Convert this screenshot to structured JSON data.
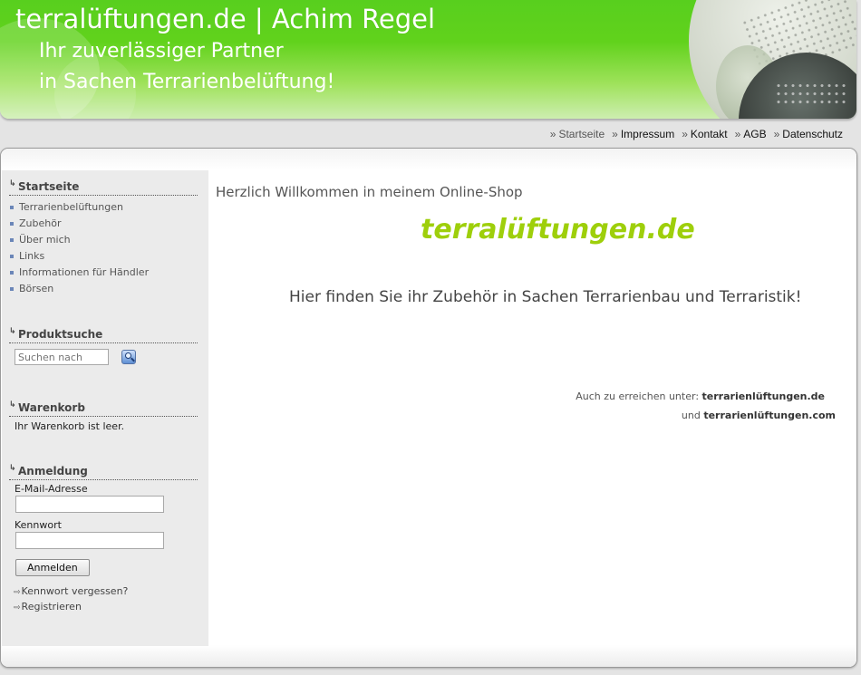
{
  "header": {
    "title": "terralüftungen.de | Achim Regel",
    "subtitle_line1": "Ihr zuverlässiger Partner",
    "subtitle_line2": "in Sachen Terrarienbelüftung!"
  },
  "topnav": {
    "separator": "»",
    "items": [
      {
        "label": "Startseite",
        "active": true
      },
      {
        "label": "Impressum",
        "active": false
      },
      {
        "label": "Kontakt",
        "active": false
      },
      {
        "label": "AGB",
        "active": false
      },
      {
        "label": "Datenschutz",
        "active": false
      }
    ]
  },
  "sidebar": {
    "home": {
      "title": "Startseite",
      "links": [
        "Terrarienbelüftungen",
        "Zubehör",
        "Über mich",
        "Links",
        "Informationen für Händler",
        "Börsen"
      ]
    },
    "search": {
      "title": "Produktsuche",
      "placeholder": "Suchen nach"
    },
    "cart": {
      "title": "Warenkorb",
      "text": "Ihr Warenkorb ist leer."
    },
    "login": {
      "title": "Anmeldung",
      "email_label": "E-Mail-Adresse",
      "password_label": "Kennwort",
      "button": "Anmelden",
      "forgot": "Kennwort vergessen?",
      "register": "Registrieren"
    }
  },
  "content": {
    "title": "Herzlich Willkommen in meinem Online-Shop",
    "brand": "terralüftungen.de",
    "tagline": "Hier finden Sie ihr Zubehör in Sachen Terrarienbau und Terraristik!",
    "alt_prefix": "Auch zu erreichen unter:",
    "alt_domain1": "terrarienlüftungen.de",
    "alt_and": "und",
    "alt_domain2": "terrarienlüftungen.com"
  },
  "colors": {
    "header_green": "#58cf1e",
    "brand_green": "#9ecf0b",
    "sidebar_bg": "#ebebeb",
    "bullet_blue": "#6b86b8"
  },
  "icons": [
    "search-icon",
    "raquo-icon",
    "arrow-icon",
    "double-arrow-icon"
  ]
}
